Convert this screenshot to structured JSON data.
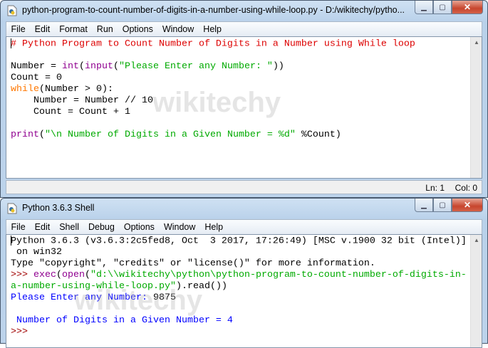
{
  "editor": {
    "title": "python-program-to-count-number-of-digits-in-a-number-using-while-loop.py - D:/wikitechy/pytho...",
    "menu": [
      "File",
      "Edit",
      "Format",
      "Run",
      "Options",
      "Window",
      "Help"
    ],
    "lines": [
      [
        {
          "t": "# Python Program to Count Number of Digits in a Number using While loop",
          "c": "#dd0000"
        }
      ],
      [],
      [
        {
          "t": "Number = ",
          "c": "#000000"
        },
        {
          "t": "int",
          "c": "#900090"
        },
        {
          "t": "(",
          "c": "#000000"
        },
        {
          "t": "input",
          "c": "#900090"
        },
        {
          "t": "(",
          "c": "#000000"
        },
        {
          "t": "\"Please Enter any Number: \"",
          "c": "#00aa00"
        },
        {
          "t": "))",
          "c": "#000000"
        }
      ],
      [
        {
          "t": "Count = 0",
          "c": "#000000"
        }
      ],
      [
        {
          "t": "while",
          "c": "#ff7700"
        },
        {
          "t": "(Number > 0):",
          "c": "#000000"
        }
      ],
      [
        {
          "t": "    Number = Number // 10",
          "c": "#000000"
        }
      ],
      [
        {
          "t": "    Count = Count + 1",
          "c": "#000000"
        }
      ],
      [],
      [
        {
          "t": "print",
          "c": "#900090"
        },
        {
          "t": "(",
          "c": "#000000"
        },
        {
          "t": "\"\\n Number of Digits in a Given Number = %d\"",
          "c": "#00aa00"
        },
        {
          "t": " %Count)",
          "c": "#000000"
        }
      ]
    ],
    "status": {
      "ln": "Ln: 1",
      "col": "Col: 0"
    }
  },
  "shell": {
    "title": "Python 3.6.3 Shell",
    "menu": [
      "File",
      "Edit",
      "Shell",
      "Debug",
      "Options",
      "Window",
      "Help"
    ],
    "lines": [
      [
        {
          "t": "Python 3.6.3 (v3.6.3:2c5fed8, Oct  3 2017, 17:26:49) [MSC v.1900 32 bit (Intel)]",
          "c": "#000000"
        }
      ],
      [
        {
          "t": " on win32",
          "c": "#000000"
        }
      ],
      [
        {
          "t": "Type \"copyright\", \"credits\" or \"license()\" for more information.",
          "c": "#000000"
        }
      ],
      [
        {
          "t": ">>> ",
          "c": "#a00000"
        },
        {
          "t": "exec",
          "c": "#900090"
        },
        {
          "t": "(",
          "c": "#000000"
        },
        {
          "t": "open",
          "c": "#900090"
        },
        {
          "t": "(",
          "c": "#000000"
        },
        {
          "t": "\"d:\\\\wikitechy\\python\\python-program-to-count-number-of-digits-in-",
          "c": "#00aa00"
        }
      ],
      [
        {
          "t": "a-number-using-while-loop.py\"",
          "c": "#00aa00"
        },
        {
          "t": ").read())",
          "c": "#000000"
        }
      ],
      [
        {
          "t": "Please Enter any Number: ",
          "c": "#0000ff"
        },
        {
          "t": "9875",
          "c": "#000000"
        }
      ],
      [],
      [
        {
          "t": " Number of Digits in a Given Number = 4",
          "c": "#0000ff"
        }
      ],
      [
        {
          "t": ">>> ",
          "c": "#a00000"
        }
      ]
    ]
  },
  "watermark": "wikitechy"
}
